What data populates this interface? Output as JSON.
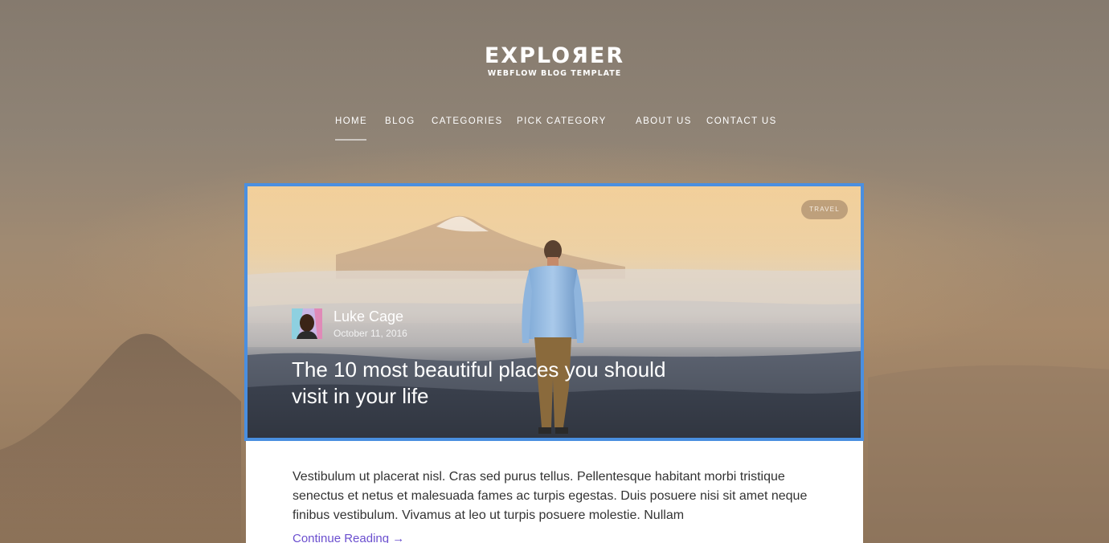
{
  "brand": {
    "name": "EXPLOЯER",
    "tagline": "WEBFLOW BLOG TEMPLATE"
  },
  "nav": {
    "home": "HOME",
    "blog": "BLOG",
    "categories": "CATEGORIES",
    "pick_category": "PICK CATEGORY",
    "about_us": "ABOUT US",
    "contact_us": "CONTACT US",
    "active": "HOME"
  },
  "featured_post": {
    "category": "TRAVEL",
    "author_name": "Luke Cage",
    "date": "October 11, 2016",
    "title": "The 10 most beautiful places you should visit in your life",
    "excerpt": "Vestibulum ut placerat nisl. Cras sed purus tellus. Pellentesque habitant morbi tristique senectus et netus et malesuada fames ac turpis egestas. Duis posuere nisi sit amet neque finibus vestibulum. Vivamus at leo ut turpis posuere molestie. Nullam",
    "continue_label": "Continue Reading →"
  },
  "colors": {
    "selection_border": "#4a8fe0",
    "link": "#6b4fcf",
    "text": "#333333"
  },
  "icons": {
    "avatar": "author-avatar"
  }
}
